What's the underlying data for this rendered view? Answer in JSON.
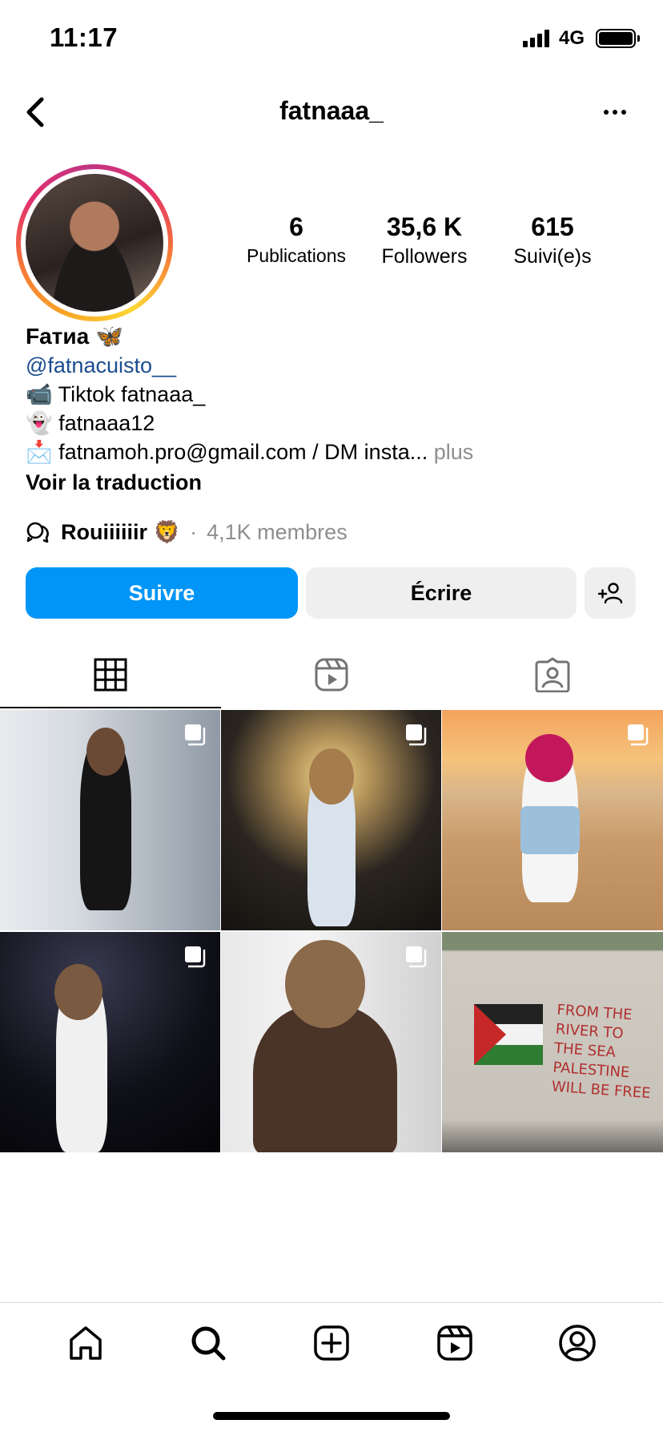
{
  "status_bar": {
    "time": "11:17",
    "network": "4G"
  },
  "header": {
    "username": "fatnaaa_"
  },
  "stats": {
    "publications": {
      "value": "6",
      "label": "Publications"
    },
    "followers": {
      "value": "35,6 K",
      "label": "Followers"
    },
    "following": {
      "value": "615",
      "label": "Suivi(e)s"
    }
  },
  "bio": {
    "name": "Fатиа 🦋",
    "handle": "@fatnacuisto__",
    "lines": [
      {
        "emoji": "📹",
        "text": "Tiktok fatnaaa_"
      },
      {
        "emoji": "👻",
        "text": "fatnaaa12"
      },
      {
        "emoji": "📩",
        "text": "fatnamoh.pro@gmail.com / DM insta..."
      }
    ],
    "more": "plus",
    "translate": "Voir la traduction"
  },
  "community": {
    "name": "Rouiiiiiir 🦁",
    "separator": "·",
    "members": "4,1K membres"
  },
  "actions": {
    "follow": "Suivre",
    "message": "Écrire"
  },
  "tabs": [
    {
      "name": "grid",
      "icon": "grid-icon"
    },
    {
      "name": "reels",
      "icon": "reels-icon"
    },
    {
      "name": "tagged",
      "icon": "tagged-icon"
    }
  ],
  "posts": [
    {
      "multi": true
    },
    {
      "multi": true
    },
    {
      "multi": true
    },
    {
      "multi": true
    },
    {
      "multi": true
    },
    {
      "multi": false
    }
  ],
  "graffiti_text": [
    "FROM THE",
    "RIVER TO",
    "THE SEA",
    "PALESTINE",
    "WILL BE FREE"
  ],
  "colors": {
    "primary": "#0095f6",
    "link": "#1a4d8f",
    "muted": "#8e8e8e",
    "button_gray": "#efefef"
  }
}
